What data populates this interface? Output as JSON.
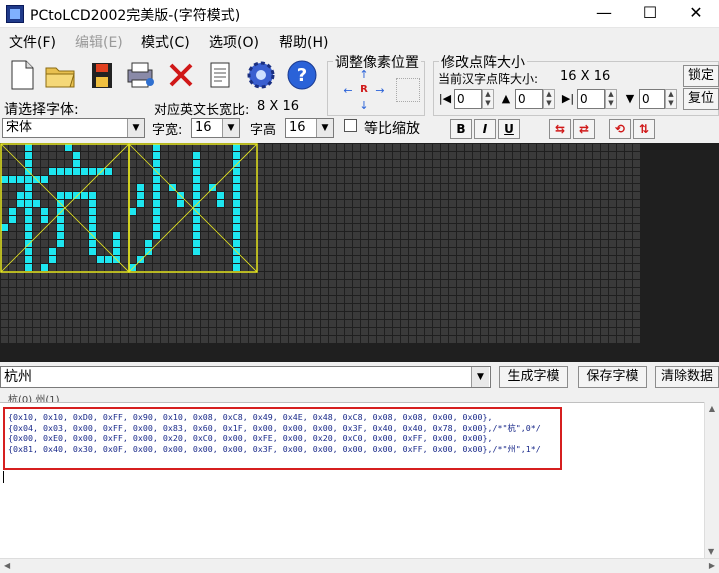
{
  "window": {
    "title": "PCtoLCD2002完美版-(字符模式)",
    "min": "—",
    "max": "☐",
    "close": "✕"
  },
  "menu": [
    {
      "label": "文件(F)",
      "disabled": false
    },
    {
      "label": "编辑(E)",
      "disabled": true
    },
    {
      "label": "模式(C)",
      "disabled": false
    },
    {
      "label": "选项(O)",
      "disabled": false
    },
    {
      "label": "帮助(H)",
      "disabled": false
    }
  ],
  "toolbar": {
    "icons": [
      "new-file-icon",
      "open-folder-icon",
      "save-disk-icon",
      "print-icon",
      "delete-x-icon",
      "document-icon",
      "gear-icon",
      "help-icon"
    ]
  },
  "pixel_adjust": {
    "title": "调整像素位置",
    "up": "↑",
    "left": "←",
    "center": "R",
    "right": "→",
    "down": "↓"
  },
  "matrix_size": {
    "title": "修改点阵大小",
    "current_label": "当前汉字点阵大小:",
    "current_value": "16 X 16",
    "lock_button": "锁定",
    "reset_button": "复位",
    "spin1": "0",
    "spin2": "0",
    "spin3": "0",
    "spin4": "0"
  },
  "font": {
    "select_label": "请选择字体:",
    "ratio_label": "对应英文长宽比:",
    "ratio_value": "8 X 16",
    "font_name": "宋体",
    "width_label": "字宽:",
    "width_value": "16",
    "height_label": "字高",
    "height_value": "16",
    "scale_label": "等比缩放",
    "bold": "B",
    "italic": "I",
    "underline": "U"
  },
  "input": {
    "text": "杭州",
    "generate_button": "生成字模",
    "save_button": "保存字模",
    "clear_button": "清除数据"
  },
  "char_tabs": "杭(0)  州(1)",
  "output_lines": [
    "{0x10, 0x10, 0xD0, 0xFF, 0x90, 0x10, 0x08, 0xC8, 0x49, 0x4E, 0x48, 0xC8, 0x08, 0x08, 0x00, 0x00},",
    "{0x04, 0x03, 0x00, 0xFF, 0x00, 0x83, 0x60, 0x1F, 0x00, 0x00, 0x00, 0x3F, 0x40, 0x40, 0x78, 0x00},/*\"杭\",0*/",
    "{0x00, 0xE0, 0x00, 0xFF, 0x00, 0x20, 0xC0, 0x00, 0xFE, 0x00, 0x20, 0xC0, 0x00, 0xFF, 0x00, 0x00},",
    "{0x81, 0x40, 0x30, 0x0F, 0x00, 0x00, 0x00, 0x00, 0x3F, 0x00, 0x00, 0x00, 0x00, 0xFF, 0x00, 0x00},/*\"州\",1*/"
  ],
  "colors": {
    "pixel_on": "#1ee6f0",
    "pixel_off": "#3a3a3a",
    "grid_bg": "#1f1f1f",
    "char_box": "#e8e820",
    "highlight": "#d61f1f"
  }
}
